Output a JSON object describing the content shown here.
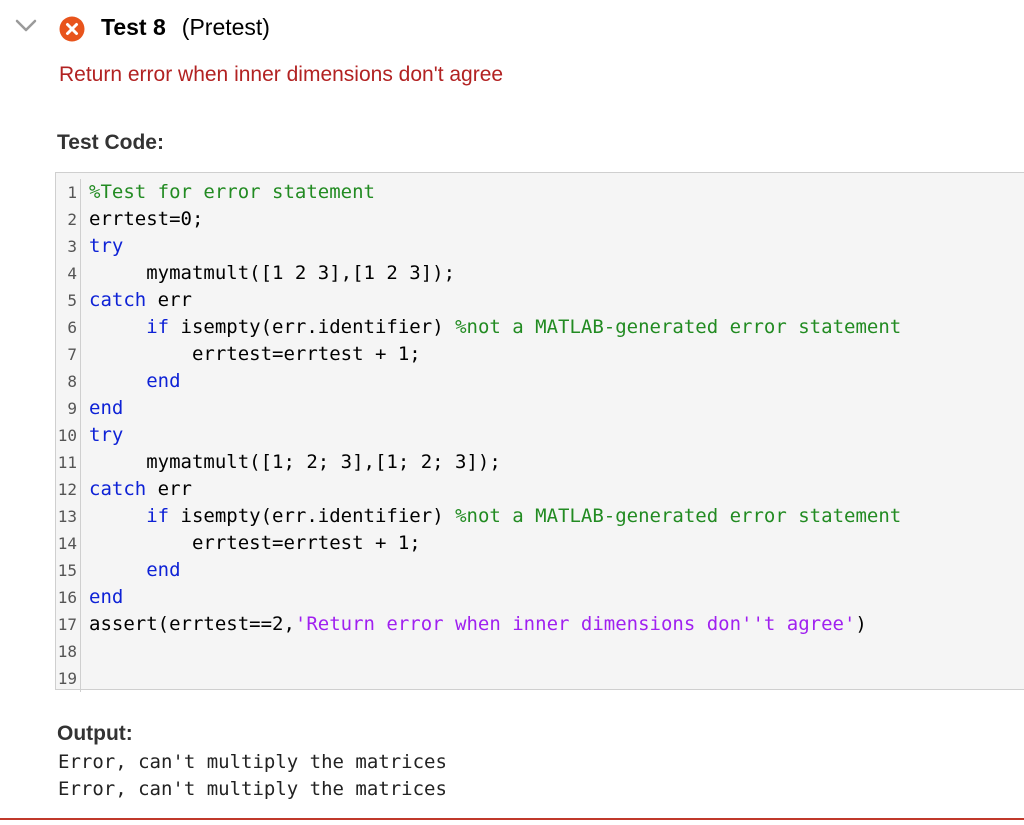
{
  "test": {
    "name": "Test 8",
    "tag": "(Pretest)",
    "status": "failed",
    "description": "Return error when inner dimensions don't agree"
  },
  "labels": {
    "test_code": "Test Code:",
    "output": "Output:"
  },
  "code_lines": [
    [
      {
        "t": "%Test for error statement",
        "c": "cm"
      }
    ],
    [
      {
        "t": "errtest=0;",
        "c": ""
      }
    ],
    [
      {
        "t": "try",
        "c": "kw"
      }
    ],
    [
      {
        "t": "     mymatmult([1 2 3],[1 2 3]);",
        "c": ""
      }
    ],
    [
      {
        "t": "catch",
        "c": "kw"
      },
      {
        "t": " err",
        "c": ""
      }
    ],
    [
      {
        "t": "     ",
        "c": ""
      },
      {
        "t": "if",
        "c": "kw"
      },
      {
        "t": " isempty(err.identifier) ",
        "c": ""
      },
      {
        "t": "%not a MATLAB-generated error statement",
        "c": "cm"
      }
    ],
    [
      {
        "t": "         errtest=errtest + 1;",
        "c": ""
      }
    ],
    [
      {
        "t": "     ",
        "c": ""
      },
      {
        "t": "end",
        "c": "kw"
      }
    ],
    [
      {
        "t": "end",
        "c": "kw"
      }
    ],
    [
      {
        "t": "try",
        "c": "kw"
      }
    ],
    [
      {
        "t": "     mymatmult([1; 2; 3],[1; 2; 3]);",
        "c": ""
      }
    ],
    [
      {
        "t": "catch",
        "c": "kw"
      },
      {
        "t": " err",
        "c": ""
      }
    ],
    [
      {
        "t": "     ",
        "c": ""
      },
      {
        "t": "if",
        "c": "kw"
      },
      {
        "t": " isempty(err.identifier) ",
        "c": ""
      },
      {
        "t": "%not a MATLAB-generated error statement",
        "c": "cm"
      }
    ],
    [
      {
        "t": "         errtest=errtest + 1;",
        "c": ""
      }
    ],
    [
      {
        "t": "     ",
        "c": ""
      },
      {
        "t": "end",
        "c": "kw"
      }
    ],
    [
      {
        "t": "end",
        "c": "kw"
      }
    ],
    [
      {
        "t": "assert(errtest==2,",
        "c": ""
      },
      {
        "t": "'Return error when inner dimensions don''t agree'",
        "c": "str"
      },
      {
        "t": ")",
        "c": ""
      }
    ],
    [],
    []
  ],
  "output_lines": [
    "Error, can't multiply the matrices",
    "Error, can't multiply the matrices"
  ],
  "colors": {
    "error_text": "#b22222",
    "fail_icon": "#e8541c",
    "keyword": "#0e22d6",
    "comment": "#228b22",
    "string": "#a020f0"
  },
  "icons": {
    "collapse": "chevron-down-icon",
    "status": "error-x-circle-icon"
  }
}
